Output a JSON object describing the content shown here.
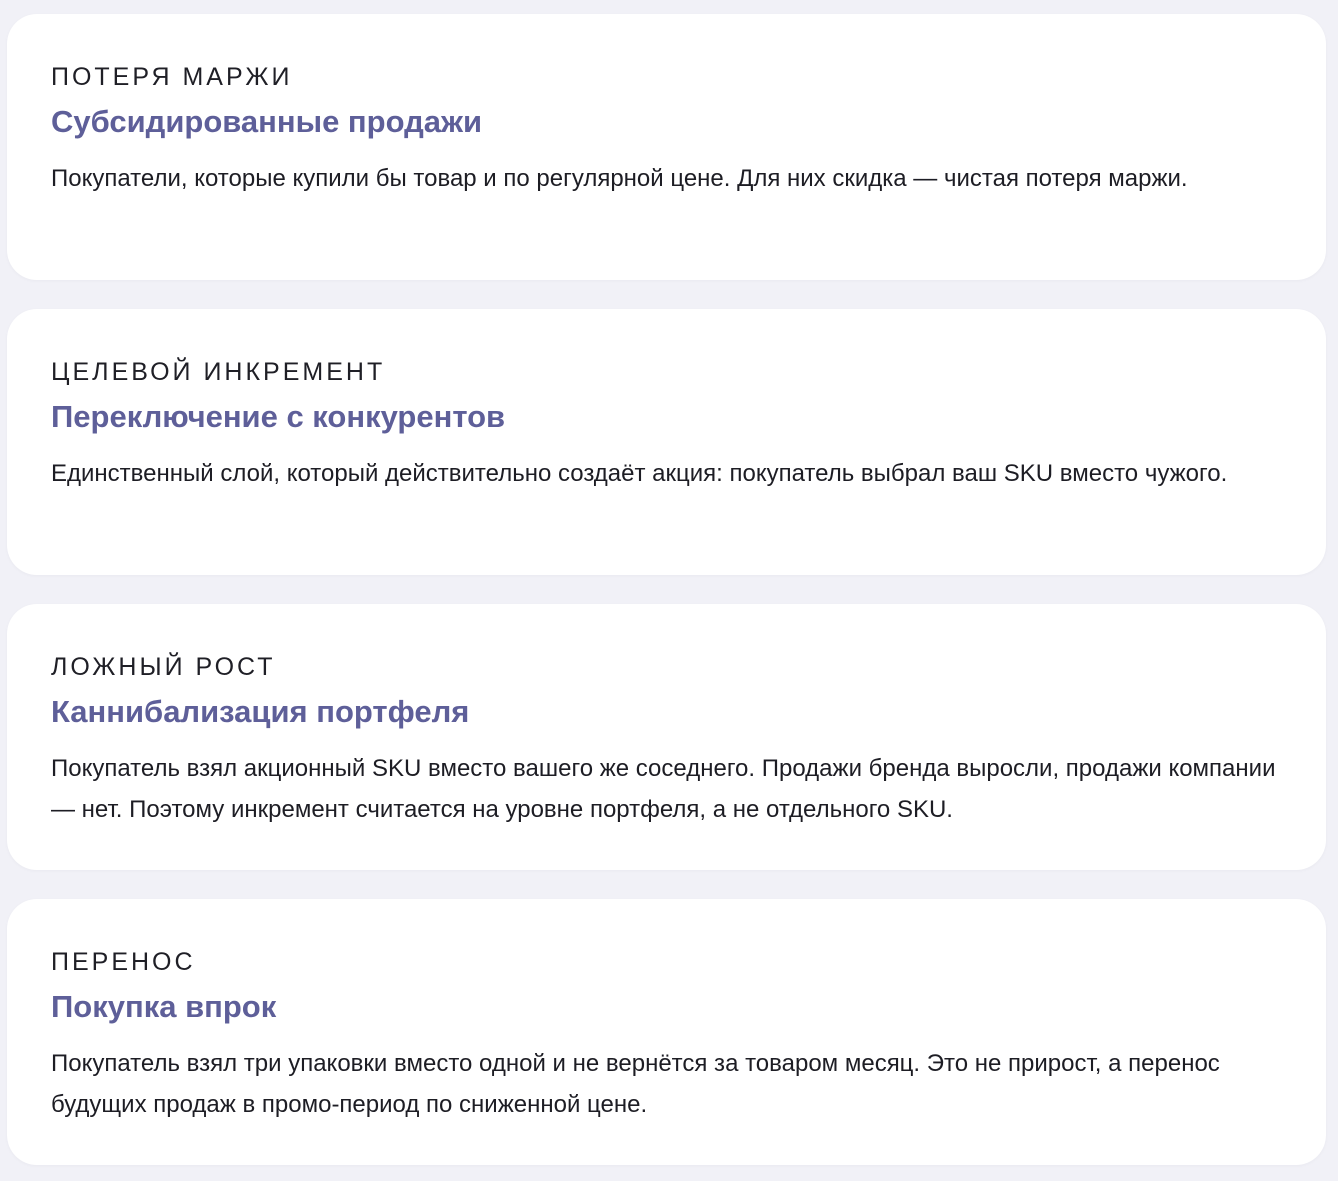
{
  "cards": [
    {
      "kicker": "ПОТЕРЯ МАРЖИ",
      "title": "Субсидированные продажи",
      "text": "Покупатели, которые купили бы товар и по регулярной цене. Для них скидка — чистая потеря маржи."
    },
    {
      "kicker": "ЦЕЛЕВОЙ ИНКРЕМЕНТ",
      "title": "Переключение с конкурентов",
      "text": "Единственный слой, который действительно создаёт акция: покупатель выбрал ваш SKU вместо чужого."
    },
    {
      "kicker": "ЛОЖНЫЙ РОСТ",
      "title": "Каннибализация портфеля",
      "text": "Покупатель взял акционный SKU вместо вашего же соседнего. Продажи бренда выросли, продажи компании — нет. Поэтому инкремент считается на уровне портфеля, а не отдельного SKU."
    },
    {
      "kicker": "ПЕРЕНОС",
      "title": "Покупка впрок",
      "text": "Покупатель взял три упаковки вместо одной и не вернётся за товаром месяц. Это не прирост, а перенос будущих продаж в промо-период по сниженной цене."
    }
  ]
}
